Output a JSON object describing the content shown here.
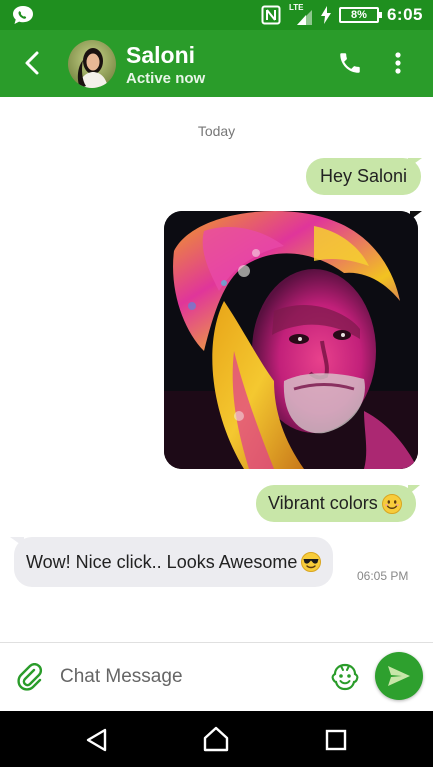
{
  "status_bar": {
    "network": "LTE",
    "battery": "8%",
    "time": "6:05"
  },
  "header": {
    "contact_name": "Saloni",
    "contact_status": "Active now",
    "icons": [
      "back-arrow-icon",
      "avatar",
      "phone-icon",
      "more-vert-icon"
    ]
  },
  "chat": {
    "day_label": "Today",
    "messages": [
      {
        "direction": "outgoing",
        "type": "text",
        "text": "Hey Saloni"
      },
      {
        "direction": "outgoing",
        "type": "image",
        "description": "colorful portrait photo"
      },
      {
        "direction": "outgoing",
        "type": "text",
        "text": "Vibrant colors",
        "emoji": "smiling-face-emoji"
      },
      {
        "direction": "incoming",
        "type": "text",
        "text": "Wow! Nice click.. Looks Awesome",
        "emoji": "sunglasses-emoji",
        "time": "06:05 PM"
      }
    ]
  },
  "composer": {
    "placeholder": "Chat Message"
  },
  "colors": {
    "status_bar": "#1f8f1f",
    "app_bar": "#2a9c2a",
    "outgoing_bubble": "#c8e6a8",
    "incoming_bubble": "#ececf0",
    "send_button": "#2ea02e"
  }
}
